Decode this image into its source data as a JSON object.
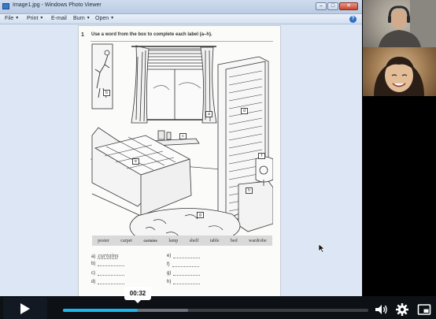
{
  "window": {
    "title": "Image1.jpg - Windows Photo Viewer",
    "controls": {
      "minimize": "–",
      "maximize": "□",
      "close": "✕"
    }
  },
  "menubar": {
    "items": [
      {
        "label": "File"
      },
      {
        "label": "Print"
      },
      {
        "label": "E-mail"
      },
      {
        "label": "Burn"
      },
      {
        "label": "Open"
      }
    ],
    "help_label": "?"
  },
  "worksheet": {
    "exercise_number": "1",
    "instruction": "Use a word from the box to complete each label (a–h).",
    "labels": [
      "a",
      "b",
      "c",
      "d",
      "e",
      "f",
      "g",
      "h"
    ],
    "word_box": [
      {
        "text": "poster",
        "done": false
      },
      {
        "text": "carpet",
        "done": false
      },
      {
        "text": "curtains",
        "done": true
      },
      {
        "text": "lamp",
        "done": false
      },
      {
        "text": "shelf",
        "done": false
      },
      {
        "text": "table",
        "done": false
      },
      {
        "text": "bed",
        "done": false
      },
      {
        "text": "wardrobe",
        "done": false
      }
    ],
    "answers": [
      {
        "letter": "a)",
        "value": "curtains"
      },
      {
        "letter": "b)",
        "value": ""
      },
      {
        "letter": "c)",
        "value": ""
      },
      {
        "letter": "d)",
        "value": ""
      },
      {
        "letter": "e)",
        "value": ""
      },
      {
        "letter": "f)",
        "value": ""
      },
      {
        "letter": "g)",
        "value": ""
      },
      {
        "letter": "h)",
        "value": ""
      }
    ]
  },
  "player": {
    "current_time": "00:32",
    "progress_fraction": 0.245,
    "buffered_fraction": 0.41,
    "accent_color": "#1ab7ea",
    "icons": [
      "play-icon",
      "volume-icon",
      "settings-icon",
      "pip-icon"
    ]
  }
}
